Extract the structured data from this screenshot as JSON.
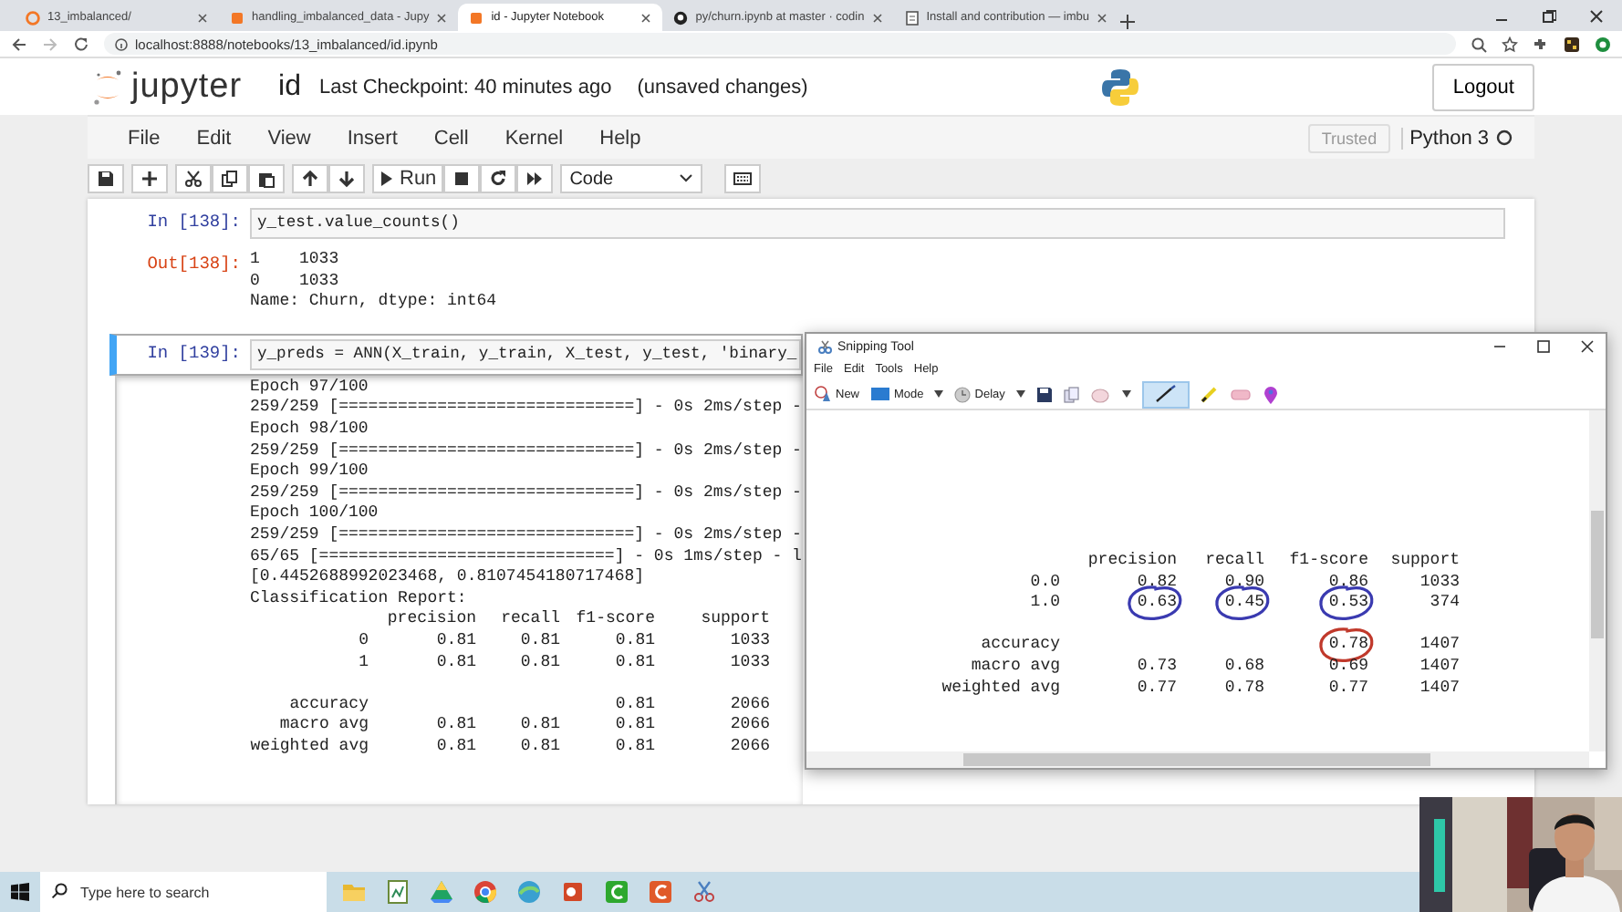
{
  "browser": {
    "tabs": [
      {
        "kind": "jupyter",
        "title": "13_imbalanced/",
        "selected": false
      },
      {
        "kind": "notebook",
        "title": "handling_imbalanced_data - Jupy",
        "selected": false
      },
      {
        "kind": "notebook",
        "title": "id - Jupyter Notebook",
        "selected": true
      },
      {
        "kind": "github",
        "title": "py/churn.ipynb at master · codin",
        "selected": false
      },
      {
        "kind": "doc",
        "title": "Install and contribution — imbu",
        "selected": false
      }
    ],
    "url": "localhost:8888/notebooks/13_imbalanced/id.ipynb"
  },
  "header": {
    "logo": "jupyter",
    "notebook": "id",
    "checkpoint": "Last Checkpoint: 40 minutes ago",
    "status": "(unsaved changes)",
    "logout": "Logout"
  },
  "menu": [
    "File",
    "Edit",
    "View",
    "Insert",
    "Cell",
    "Kernel",
    "Help"
  ],
  "trusted": "Trusted",
  "kernel": "Python 3",
  "toolbar": {
    "run": "Run",
    "cell_type": "Code"
  },
  "cells": [
    {
      "kind": "input",
      "prompt": "In [138]:",
      "source": "y_test.value_counts()",
      "selected": false
    },
    {
      "kind": "output",
      "prompt": "Out[138]:",
      "lines": [
        "1    1033",
        "0    1033",
        "Name: Churn, dtype: int64"
      ]
    },
    {
      "kind": "input",
      "prompt": "In [139]:",
      "source": "y_preds = ANN(X_train, y_train, X_test, y_test, 'binary_",
      "selected": true
    },
    {
      "kind": "stream",
      "lines": [
        "Epoch 97/100",
        "259/259 [==============================] - 0s 2ms/step -",
        "Epoch 98/100",
        "259/259 [==============================] - 0s 2ms/step -",
        "Epoch 99/100",
        "259/259 [==============================] - 0s 2ms/step -",
        "Epoch 100/100",
        "259/259 [==============================] - 0s 2ms/step -",
        "65/65 [==============================] - 0s 1ms/step - l",
        "[0.4452688992023468, 0.8107454180717468]",
        "Classification Report:"
      ],
      "report": {
        "columns": [
          "precision",
          "recall",
          "f1-score",
          "support"
        ],
        "sections": [
          [
            {
              "label": "0",
              "cells": [
                "0.81",
                "0.81",
                "0.81",
                "1033"
              ]
            },
            {
              "label": "1",
              "cells": [
                "0.81",
                "0.81",
                "0.81",
                "1033"
              ]
            }
          ],
          [
            {
              "label": "accuracy",
              "cells": [
                "",
                "",
                "0.81",
                "2066"
              ]
            },
            {
              "label": "macro avg",
              "cells": [
                "0.81",
                "0.81",
                "0.81",
                "2066"
              ]
            },
            {
              "label": "weighted avg",
              "cells": [
                "0.81",
                "0.81",
                "0.81",
                "2066"
              ]
            }
          ]
        ]
      }
    }
  ],
  "snipping_tool": {
    "title": "Snipping Tool",
    "menu": [
      "File",
      "Edit",
      "Tools",
      "Help"
    ],
    "new": "New",
    "mode": "Mode",
    "delay": "Delay",
    "report": {
      "columns": [
        "precision",
        "recall",
        "f1-score",
        "support"
      ],
      "sections": [
        [
          {
            "label": "0.0",
            "cells": [
              "0.82",
              "0.90",
              "0.86",
              "1033"
            ]
          },
          {
            "label": "1.0",
            "cells": [
              {
                "text": "0.63",
                "color": "#3a3ab0"
              },
              {
                "text": "0.45",
                "color": "#3a3ab0"
              },
              {
                "text": "0.53",
                "color": "#3a3ab0"
              },
              "374"
            ]
          }
        ],
        [
          {
            "label": "accuracy",
            "cells": [
              "",
              "",
              {
                "text": "0.78",
                "color": "#c0392b"
              },
              "1407"
            ]
          },
          {
            "label": "macro avg",
            "cells": [
              "0.73",
              "0.68",
              "0.69",
              "1407"
            ]
          },
          {
            "label": "weighted avg",
            "cells": [
              "0.77",
              "0.78",
              "0.77",
              "1407"
            ]
          }
        ]
      ]
    }
  },
  "taskbar": {
    "search": {
      "placeholder": "Type here to search"
    }
  }
}
